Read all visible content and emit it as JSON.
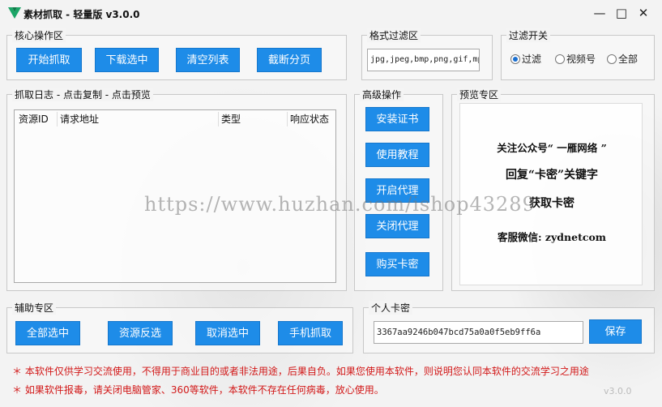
{
  "app": {
    "title": "素材抓取 - 轻量版 v3.0.0",
    "minimize_glyph": "—",
    "maximize_glyph": "□",
    "close_glyph": "✕",
    "version_footer": "v3.0.0"
  },
  "core_ops": {
    "title": "核心操作区",
    "buttons": [
      "开始抓取",
      "下载选中",
      "清空列表",
      "截断分页"
    ]
  },
  "format_filter": {
    "title": "格式过滤区",
    "value": "jpg,jpeg,bmp,png,gif,mp"
  },
  "filter_switch": {
    "title": "过滤开关",
    "options": [
      "过滤",
      "视频号",
      "全部"
    ],
    "selected": "过滤"
  },
  "log": {
    "title": "抓取日志 - 点击复制 - 点击预览",
    "columns": [
      "资源ID",
      "请求地址",
      "类型",
      "响应状态"
    ]
  },
  "advanced": {
    "title": "高级操作",
    "buttons": [
      "安装证书",
      "使用教程",
      "开启代理",
      "关闭代理",
      "购买卡密"
    ]
  },
  "preview": {
    "title": "预览专区",
    "line1": "关注公众号“ 一雁网络 ”",
    "line2": "回复“卡密”关键字",
    "line3": "获取卡密",
    "line4": "客服微信: zydnetcom"
  },
  "aux": {
    "title": "辅助专区",
    "buttons": [
      "全部选中",
      "资源反选",
      "取消选中",
      "手机抓取"
    ]
  },
  "card": {
    "title": "个人卡密",
    "value": "3367aa9246b047bcd75a0a0f5eb9ff6a",
    "save_label": "保存"
  },
  "notices": [
    "＊ 本软件仅供学习交流使用，不得用于商业目的或者非法用途，后果自负。如果您使用本软件，则说明您认同本软件的交流学习之用途",
    "＊ 如果软件报毒，请关闭电脑管家、360等软件，本软件不存在任何病毒，放心使用。"
  ],
  "watermark": "https://www.huzhan.com/ishop43289",
  "colors": {
    "button_blue": "#1e8ce8",
    "notice_red": "#d21818",
    "logo_green": "#1aa566"
  }
}
